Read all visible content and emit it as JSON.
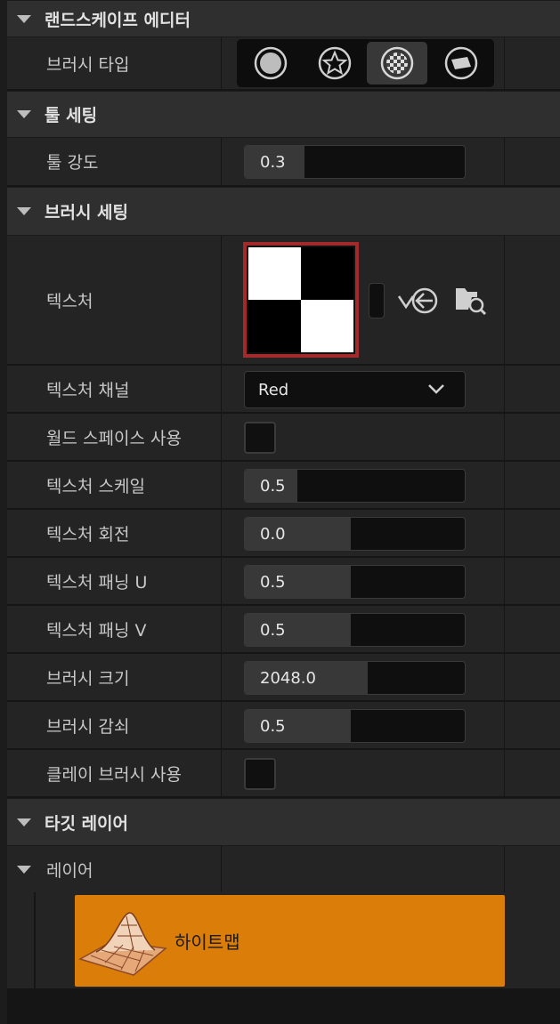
{
  "sections": {
    "landscape_editor": "랜드스케이프 에디터",
    "tool_settings": "툴 세팅",
    "brush_settings": "브러시 세팅",
    "target_layers": "타깃 레이어"
  },
  "landscape_editor": {
    "brush_type_label": "브러시 타입",
    "brush_types": [
      {
        "icon": "circle-brush-icon",
        "active": false
      },
      {
        "icon": "star-brush-icon",
        "active": false
      },
      {
        "icon": "alpha-brush-icon",
        "active": true
      },
      {
        "icon": "pattern-brush-icon",
        "active": false
      }
    ]
  },
  "tool_settings": {
    "strength_label": "툴 강도",
    "strength_value": "0.3",
    "strength_fill": 0.3
  },
  "brush_settings": {
    "texture_label": "텍스처",
    "texture_channel_label": "텍스처 채널",
    "texture_channel_value": "Red",
    "use_world_space_label": "월드 스페이스 사용",
    "use_world_space": false,
    "texture_scale_label": "텍스처 스케일",
    "texture_scale_value": "0.5",
    "texture_scale_fill": 0.25,
    "texture_rotation_label": "텍스처 회전",
    "texture_rotation_value": "0.0",
    "texture_rotation_fill": 0.48,
    "texture_pan_u_label": "텍스처 패닝 U",
    "texture_pan_u_value": "0.5",
    "texture_pan_u_fill": 0.48,
    "texture_pan_v_label": "텍스처 패닝 V",
    "texture_pan_v_value": "0.5",
    "texture_pan_v_fill": 0.48,
    "brush_size_label": "브러시 크기",
    "brush_size_value": "2048.0",
    "brush_size_fill": 0.56,
    "brush_falloff_label": "브러시 감쇠",
    "brush_falloff_value": "0.5",
    "brush_falloff_fill": 0.48,
    "use_clay_brush_label": "클레이 브러시 사용",
    "use_clay_brush": false
  },
  "target_layers": {
    "layers_label": "레이어",
    "heightmap_label": "하이트맵",
    "heightmap_color": "#db7d09"
  },
  "colors": {
    "panel_bg": "#242424",
    "header_bg": "#2f2f2f",
    "texture_border": "#a22a2a"
  }
}
